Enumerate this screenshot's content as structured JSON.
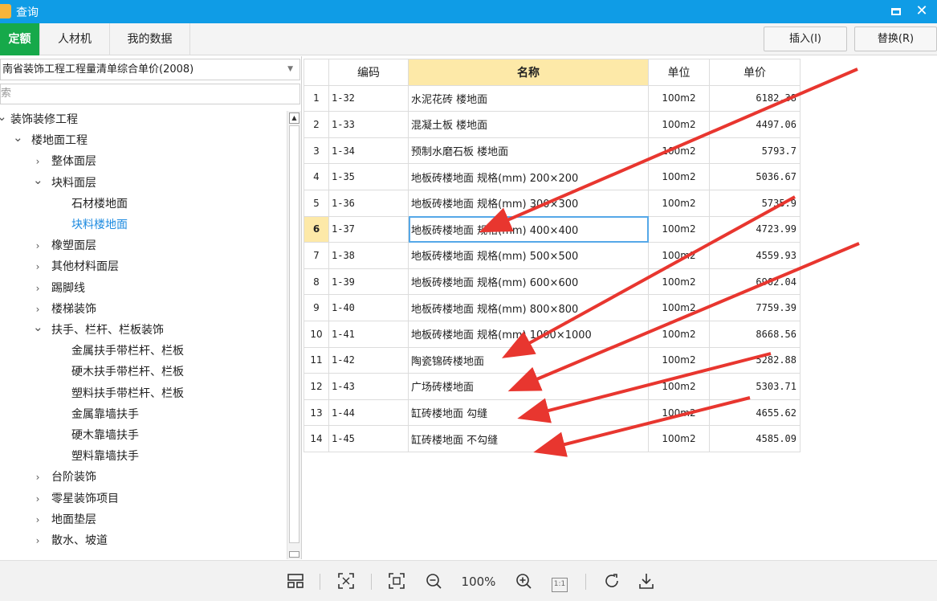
{
  "window": {
    "title": "查询"
  },
  "tabs": [
    {
      "label": "定额",
      "active": true
    },
    {
      "label": "人材机",
      "active": false
    },
    {
      "label": "我的数据",
      "active": false
    }
  ],
  "toolbar": {
    "insert_label": "插入(I)",
    "replace_label": "替换(R)"
  },
  "library": {
    "selected": "南省装饰工程工程量清单综合单价(2008)"
  },
  "search": {
    "placeholder": "搜索"
  },
  "tree": [
    {
      "label": "装饰装修工程",
      "expanded": true
    },
    {
      "label": "楼地面工程",
      "expanded": true
    },
    {
      "label": "整体面层",
      "expanded": false
    },
    {
      "label": "块料面层",
      "expanded": true
    },
    {
      "label": "石材楼地面"
    },
    {
      "label": "块料楼地面",
      "selected": true
    },
    {
      "label": "橡塑面层",
      "expanded": false
    },
    {
      "label": "其他材料面层",
      "expanded": false
    },
    {
      "label": "踢脚线",
      "expanded": false
    },
    {
      "label": "楼梯装饰",
      "expanded": false
    },
    {
      "label": "扶手、栏杆、栏板装饰",
      "expanded": true
    },
    {
      "label": "金属扶手带栏杆、栏板"
    },
    {
      "label": "硬木扶手带栏杆、栏板"
    },
    {
      "label": "塑料扶手带栏杆、栏板"
    },
    {
      "label": "金属靠墙扶手"
    },
    {
      "label": "硬木靠墙扶手"
    },
    {
      "label": "塑料靠墙扶手"
    },
    {
      "label": "台阶装饰",
      "expanded": false
    },
    {
      "label": "零星装饰项目",
      "expanded": false
    },
    {
      "label": "地面垫层",
      "expanded": false
    },
    {
      "label": "散水、坡道",
      "expanded": false
    }
  ],
  "table": {
    "columns": [
      "编码",
      "名称",
      "单位",
      "单价"
    ],
    "current_row": 6,
    "rows": [
      {
        "idx": "1",
        "code": "1-32",
        "name": "水泥花砖 楼地面",
        "unit": "100m2",
        "price": "6182.38"
      },
      {
        "idx": "2",
        "code": "1-33",
        "name": "混凝土板 楼地面",
        "unit": "100m2",
        "price": "4497.06"
      },
      {
        "idx": "3",
        "code": "1-34",
        "name": "预制水磨石板 楼地面",
        "unit": "100m2",
        "price": "5793.7"
      },
      {
        "idx": "4",
        "code": "1-35",
        "name": "地板砖楼地面 规格(mm) 200×200",
        "unit": "100m2",
        "price": "5036.67"
      },
      {
        "idx": "5",
        "code": "1-36",
        "name": "地板砖楼地面 规格(mm) 300×300",
        "unit": "100m2",
        "price": "5735.9"
      },
      {
        "idx": "6",
        "code": "1-37",
        "name": "地板砖楼地面 规格(mm) 400×400",
        "unit": "100m2",
        "price": "4723.99"
      },
      {
        "idx": "7",
        "code": "1-38",
        "name": "地板砖楼地面 规格(mm) 500×500",
        "unit": "100m2",
        "price": "4559.93"
      },
      {
        "idx": "8",
        "code": "1-39",
        "name": "地板砖楼地面 规格(mm) 600×600",
        "unit": "100m2",
        "price": "6902.04"
      },
      {
        "idx": "9",
        "code": "1-40",
        "name": "地板砖楼地面 规格(mm) 800×800",
        "unit": "100m2",
        "price": "7759.39"
      },
      {
        "idx": "10",
        "code": "1-41",
        "name": "地板砖楼地面 规格(mm) 1000×1000",
        "unit": "100m2",
        "price": "8668.56"
      },
      {
        "idx": "11",
        "code": "1-42",
        "name": "陶瓷锦砖楼地面",
        "unit": "100m2",
        "price": "5282.88"
      },
      {
        "idx": "12",
        "code": "1-43",
        "name": "广场砖楼地面",
        "unit": "100m2",
        "price": "5303.71"
      },
      {
        "idx": "13",
        "code": "1-44",
        "name": "缸砖楼地面 勾缝",
        "unit": "100m2",
        "price": "4655.62"
      },
      {
        "idx": "14",
        "code": "1-45",
        "name": "缸砖楼地面 不勾缝",
        "unit": "100m2",
        "price": "4585.09"
      }
    ]
  },
  "viewer": {
    "zoom": "100%",
    "actual_size_label": "1:1"
  },
  "colors": {
    "titlebar": "#0f9ce6",
    "active_tab": "#16a94a",
    "header_highlight": "#fde9a8",
    "selected_text": "#1e8be0",
    "annotation": "#e8362f"
  }
}
